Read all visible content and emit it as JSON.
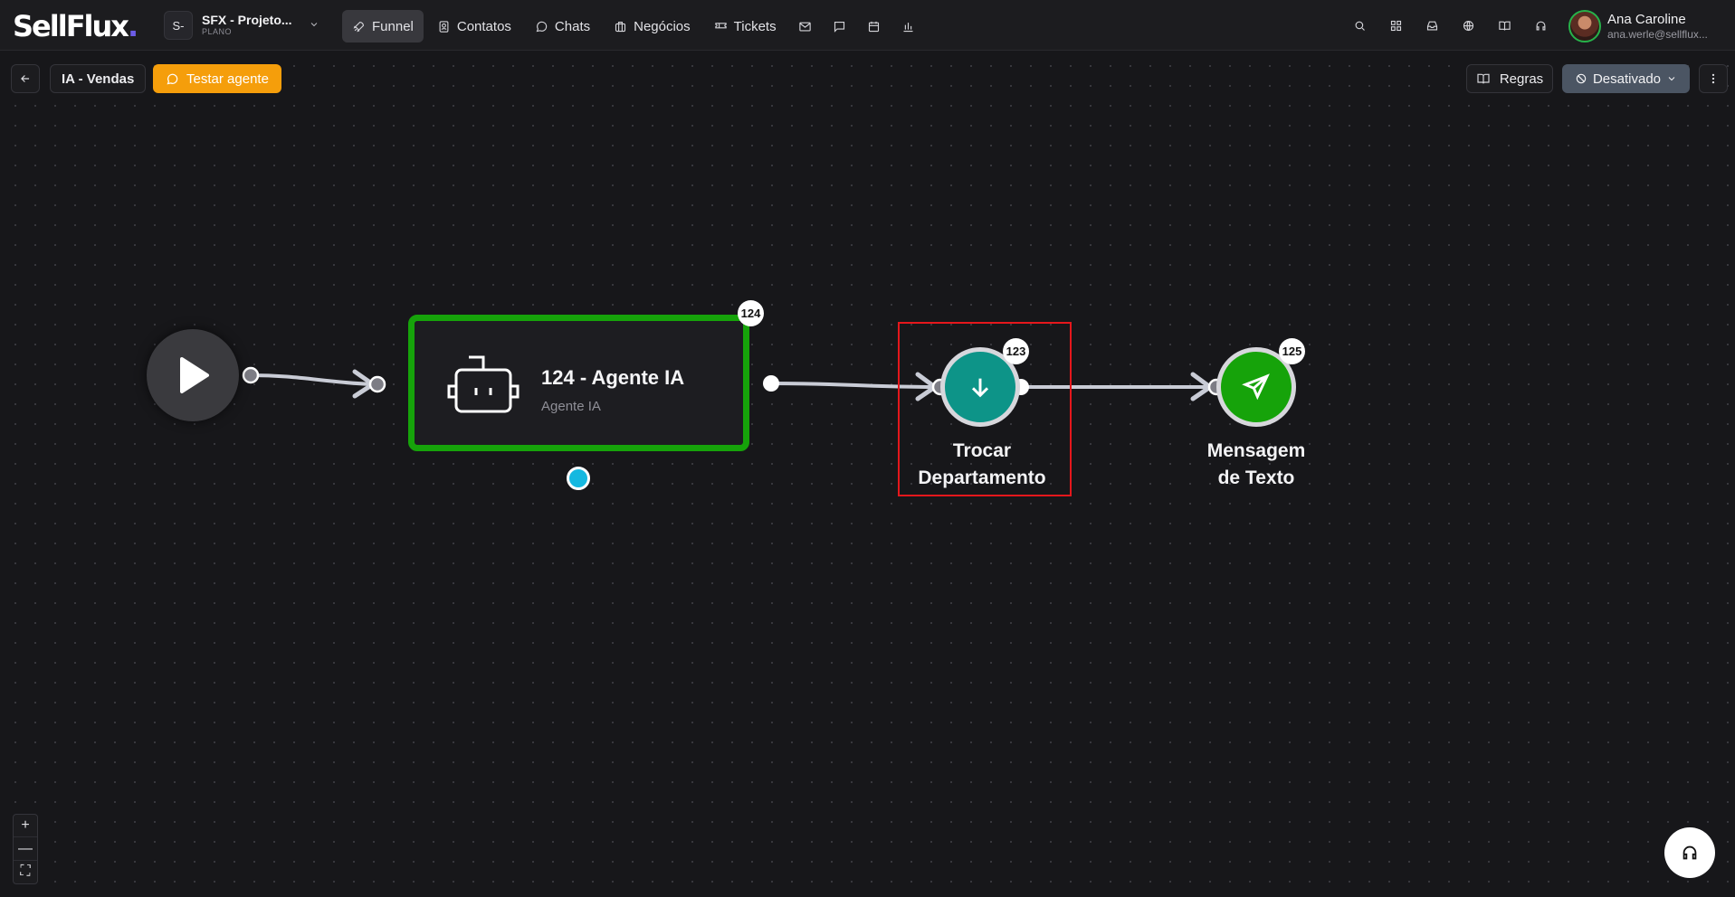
{
  "header": {
    "logo_text": "SellFlux",
    "workspace": {
      "avatar": "S-",
      "name": "SFX - Projeto...",
      "plan": "PLANO"
    },
    "nav": [
      {
        "label": "Funnel",
        "icon": "rocket-icon",
        "active": true
      },
      {
        "label": "Contatos",
        "icon": "contacts-icon"
      },
      {
        "label": "Chats",
        "icon": "chat-icon"
      },
      {
        "label": "Negócios",
        "icon": "briefcase-icon"
      },
      {
        "label": "Tickets",
        "icon": "ticket-icon"
      }
    ],
    "nav_icons": [
      "mail-icon",
      "message-square-icon",
      "calendar-icon",
      "bar-chart-icon"
    ],
    "right_icons": [
      "search-icon",
      "apps-grid-icon",
      "inbox-icon",
      "globe-icon",
      "book-icon",
      "headset-icon"
    ],
    "user": {
      "name": "Ana Caroline",
      "email": "ana.werle@sellflux..."
    }
  },
  "toolbar": {
    "flow_name": "IA - Vendas",
    "test_label": "Testar agente",
    "rules_label": "Regras",
    "status_label": "Desativado",
    "colors": {
      "test": "#f59e0b",
      "status": "#4b5563"
    }
  },
  "flow": {
    "agent_node": {
      "badge": "124",
      "title": "124 - Agente IA",
      "subtitle": "Agente IA",
      "border_color": "#16a30a"
    },
    "dept_node": {
      "badge": "123",
      "label_line1": "Trocar",
      "label_line2": "Departamento",
      "color": "#0d9488"
    },
    "message_node": {
      "badge": "125",
      "label_line1": "Mensagem",
      "label_line2": "de Texto",
      "color": "#16a30a"
    }
  },
  "zoom": {
    "in": "+",
    "out": "—",
    "fit": "⛶"
  }
}
